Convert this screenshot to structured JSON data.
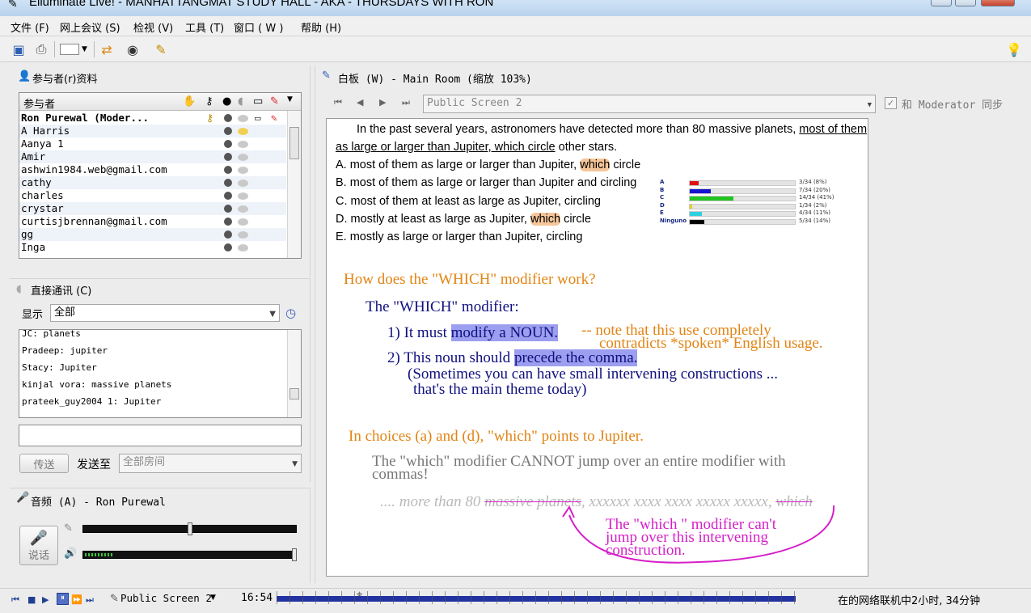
{
  "window": {
    "title": "Elluminate Live! - MANHATTANGMAT STUDY HALL - AKA - THURSDAYS WITH RON"
  },
  "menu": [
    "文件 (F)",
    "网上会议 (S)",
    "检视 (V)",
    "工具 (T)",
    "窗口 ( W )",
    "帮助 (H)"
  ],
  "participants": {
    "title": "参与者(r)资料",
    "column_header": "参与者",
    "rows": [
      "Ron Purewal (Moder...",
      "A Harris",
      "Aanya 1",
      "Amir",
      "ashwin1984.web@gmail.com",
      "cathy",
      "charles",
      "crystar",
      "curtisjbrennan@gmail.com",
      "gg",
      "Inga"
    ]
  },
  "chat": {
    "title": "直接通讯 (C)",
    "show_label": "显示",
    "filter": "全部",
    "messages": [
      "JC: planets",
      "Pradeep: jupiter",
      "Stacy: Jupiter",
      "kinjal vora: massive planets",
      "prateek_guy2004 1: Jupiter"
    ],
    "input_value": "",
    "send_button": "传送",
    "send_to_label": "发送至",
    "send_to_value": "全部房间"
  },
  "audio": {
    "title": "音频 (A) - Ron Purewal",
    "talk_button": "说话",
    "mic_level": 0.5,
    "speaker_level": 1.0
  },
  "whiteboard": {
    "title": "白板 (W) - Main Room (缩放 103%)",
    "screen_select": "Public Screen 2",
    "sync_label": "和 Moderator 同步",
    "sync_checked": true,
    "question": {
      "stem_1": "In the past several years, astronomers have detected more than 80 massive planets,",
      "stem_underlined_1": "most of them",
      "stem_underlined_2": "as large or larger than Jupiter, which circle",
      "stem_2": "other stars.",
      "choices": [
        {
          "prefix": "A. most of them as large or larger than Jupiter, ",
          "hl": "which",
          "suffix": " circle"
        },
        {
          "prefix": "B. most of them as large or larger than Jupiter and circling",
          "hl": "",
          "suffix": ""
        },
        {
          "prefix": "C. most of them at least as large as Jupiter, circling",
          "hl": "",
          "suffix": ""
        },
        {
          "prefix": "D. mostly at least as large as Jupiter, ",
          "hl": "which",
          "suffix": " circle"
        },
        {
          "prefix": "E. mostly as large or larger than Jupiter, circling",
          "hl": "",
          "suffix": ""
        }
      ]
    },
    "poll": [
      {
        "label": "A",
        "text": "3/34 (8%)",
        "fraction": 0.08,
        "color": "#e01010"
      },
      {
        "label": "B",
        "text": "7/34 (20%)",
        "fraction": 0.2,
        "color": "#1414d0"
      },
      {
        "label": "C",
        "text": "14/34 (41%)",
        "fraction": 0.41,
        "color": "#22c422"
      },
      {
        "label": "D",
        "text": "1/34 (2%)",
        "fraction": 0.02,
        "color": "#e6d21a"
      },
      {
        "label": "E",
        "text": "4/34 (11%)",
        "fraction": 0.11,
        "color": "#2ed0e0"
      },
      {
        "label": "Ninguno",
        "text": "5/34 (14%)",
        "fraction": 0.14,
        "color": "#000000"
      }
    ],
    "notes": {
      "heading": "How does the \"WHICH\" modifier work?",
      "sub": "The \"WHICH\" modifier:",
      "p1_a": "1) It must ",
      "p1_b": "modify a NOUN.",
      "p1_note_1": "-- note that this use completely",
      "p1_note_2": "contradicts *spoken* English usage.",
      "p2_a": "2) This noun should ",
      "p2_b": "precede the comma.",
      "p2_c": "(Sometimes you can have small intervening constructions ...",
      "p2_d": "that's the main theme today)",
      "choices_note": "In choices (a) and (d), \"which\" points to Jupiter.",
      "cannot_1": "The \"which\" modifier CANNOT jump over an entire modifier with",
      "cannot_2": "commas!",
      "example_a": ".... more than 80 ",
      "example_b": "massive planets",
      "example_c": ", xxxxxx xxxx xxxx xxxxx xxxxx, ",
      "example_d": "which",
      "hand_1": "The \"which \" modifier can't",
      "hand_2": "jump over this intervening",
      "hand_3": "construction."
    }
  },
  "statusbar": {
    "screen": "Public Screen 2",
    "time": "16:54",
    "online": "在的网络联机中2小时, 34分钟"
  }
}
